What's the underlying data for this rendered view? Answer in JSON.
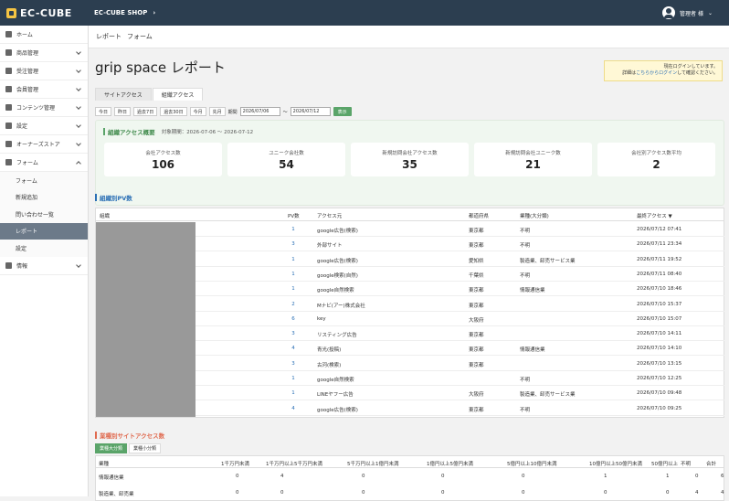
{
  "topbar": {
    "logo_text": "EC-CUBE",
    "shop_name": "EC-CUBE SHOP",
    "user_label": "管理者 様"
  },
  "sidebar": {
    "items": [
      {
        "label": "ホーム",
        "icon": "home-icon"
      },
      {
        "label": "商品管理",
        "icon": "tag-icon"
      },
      {
        "label": "受注管理",
        "icon": "cart-icon"
      },
      {
        "label": "会員管理",
        "icon": "users-icon"
      },
      {
        "label": "コンテンツ管理",
        "icon": "file-icon"
      },
      {
        "label": "設定",
        "icon": "gear-icon"
      },
      {
        "label": "オーナーズストア",
        "icon": "plug-icon"
      },
      {
        "label": "フォーム",
        "icon": "form-icon"
      }
    ],
    "sub_items": [
      {
        "label": "フォーム",
        "active": false
      },
      {
        "label": "新規追加",
        "active": false
      },
      {
        "label": "問い合わせ一覧",
        "active": false
      },
      {
        "label": "レポート",
        "active": true
      },
      {
        "label": "設定",
        "active": false
      }
    ],
    "last_item": {
      "label": "情報",
      "icon": "info-icon"
    }
  },
  "breadcrumb": {
    "section": "レポート",
    "sub": "フォーム"
  },
  "page_title": "grip space レポート",
  "notice": {
    "line1": "現在ログインしています。",
    "line2_pre": "詳細は",
    "link": "こちらからログイン",
    "line2_post": "して確認ください。"
  },
  "tabs": [
    {
      "label": "サイトアクセス",
      "active": false
    },
    {
      "label": "組織アクセス",
      "active": true
    }
  ],
  "filter": {
    "buttons": [
      "今日",
      "昨日",
      "過去7日",
      "過去30日",
      "今月",
      "先月"
    ],
    "from_label": "期間",
    "from_value": "2026/07/06",
    "to_label": "〜",
    "to_value": "2026/07/12",
    "submit": "表示"
  },
  "summary": {
    "title": "組織アクセス概要",
    "period": "対象期間：2026-07-06 〜 2026-07-12",
    "kpis": [
      {
        "label": "会社アクセス数",
        "value": "106"
      },
      {
        "label": "ユニーク会社数",
        "value": "54"
      },
      {
        "label": "新規訪問会社アクセス数",
        "value": "35"
      },
      {
        "label": "新規訪問会社ユニーク数",
        "value": "21"
      },
      {
        "label": "会社別アクセス数平均",
        "value": "2"
      }
    ]
  },
  "org_table": {
    "title": "組織別PV数",
    "headers": [
      "組織",
      "PV数",
      "アクセス元",
      "都道府県",
      "業種(大分類)",
      "最終アクセス ▼"
    ],
    "rows": [
      {
        "pv": "1",
        "source": "google広告(検索)",
        "pref": "東京都",
        "industry": "不明",
        "last": "2026/07/12 07:41"
      },
      {
        "pv": "3",
        "source": "外部サイト",
        "pref": "東京都",
        "industry": "不明",
        "last": "2026/07/11 23:34"
      },
      {
        "pv": "1",
        "source": "google広告(検索)",
        "pref": "愛知県",
        "industry": "製造業、卸売サービス業",
        "last": "2026/07/11 19:52"
      },
      {
        "pv": "1",
        "source": "google検索(自然)",
        "pref": "千葉県",
        "industry": "不明",
        "last": "2026/07/11 08:40"
      },
      {
        "pv": "1",
        "source": "google自然検索",
        "pref": "東京都",
        "industry": "情報通信業",
        "last": "2026/07/10 18:46"
      },
      {
        "pv": "2",
        "source": "Mナビ(アー)株式会社",
        "pref": "東京都",
        "industry": "",
        "last": "2026/07/10 15:37"
      },
      {
        "pv": "6",
        "source": "key",
        "pref": "大阪府",
        "industry": "",
        "last": "2026/07/10 15:07"
      },
      {
        "pv": "3",
        "source": "リスティング広告",
        "pref": "東京都",
        "industry": "",
        "last": "2026/07/10 14:11"
      },
      {
        "pv": "4",
        "source": "青光(投稿)",
        "pref": "東京都",
        "industry": "情報通信業",
        "last": "2026/07/10 14:10"
      },
      {
        "pv": "3",
        "source": "古河(検索)",
        "pref": "東京都",
        "industry": "",
        "last": "2026/07/10 13:15"
      },
      {
        "pv": "1",
        "source": "google自然検索",
        "pref": "",
        "industry": "不明",
        "last": "2026/07/10 12:25"
      },
      {
        "pv": "1",
        "source": "LINEヤフー広告",
        "pref": "大阪府",
        "industry": "製造業、卸売サービス業",
        "last": "2026/07/10 09:48"
      },
      {
        "pv": "4",
        "source": "google広告(検索)",
        "pref": "東京都",
        "industry": "不明",
        "last": "2026/07/10 09:25"
      }
    ]
  },
  "scale_section": {
    "title": "業種別サイトアクセス数",
    "subtabs": [
      {
        "label": "業種大分類",
        "active": true
      },
      {
        "label": "業種小分類",
        "active": false
      }
    ],
    "headers": [
      "業種",
      "1千万円未満",
      "1千万円以上5千万円未満",
      "5千万円以上1億円未満",
      "1億円以上5億円未満",
      "5億円以上10億円未満",
      "10億円以上50億円未満",
      "50億円以上",
      "不明",
      "合計"
    ],
    "rows": [
      {
        "name": "情報通信業",
        "values": [
          "0",
          "4",
          "0",
          "0",
          "0",
          "1",
          "1",
          "0",
          "6"
        ]
      },
      {
        "name": "製造業、卸売業",
        "values": [
          "0",
          "0",
          "0",
          "0",
          "0",
          "0",
          "0",
          "4",
          "4"
        ]
      }
    ]
  }
}
